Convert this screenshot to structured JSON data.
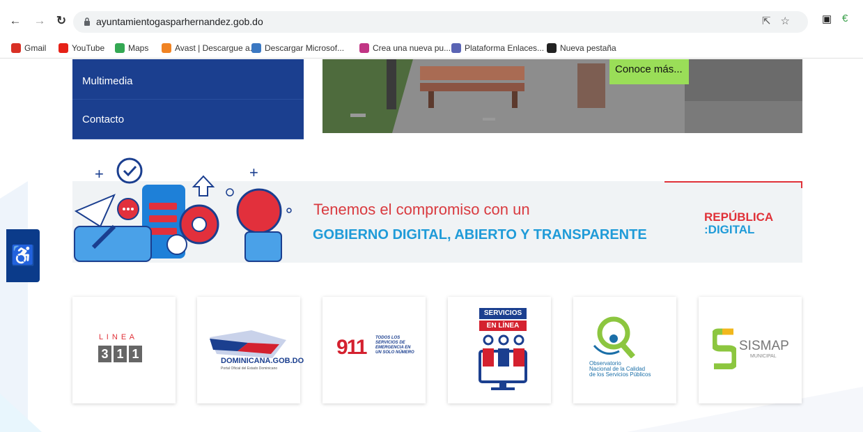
{
  "browser": {
    "url": "ayuntamientogasparhernandez.gob.do",
    "bookmarks": [
      {
        "label": "Gmail",
        "icon": "gmail-icon",
        "color": "#d93025"
      },
      {
        "label": "YouTube",
        "icon": "youtube-icon",
        "color": "#e62117"
      },
      {
        "label": "Maps",
        "icon": "maps-icon",
        "color": "#34a853"
      },
      {
        "label": "Avast | Descargue a...",
        "icon": "avast-icon",
        "color": "#f08323"
      },
      {
        "label": "Descargar Microsof...",
        "icon": "microsoft-icon",
        "color": "#3b78c2"
      },
      {
        "label": "Crea una nueva pu...",
        "icon": "instagram-icon",
        "color": "#c13584"
      },
      {
        "label": "Plataforma Enlaces...",
        "icon": "search-icon",
        "color": "#5a64b4"
      },
      {
        "label": "Nueva pestaña",
        "icon": "globe-icon",
        "color": "#222222"
      }
    ]
  },
  "menu": {
    "items": [
      "Multimedia",
      "Contacto"
    ]
  },
  "hero": {
    "cta": "Conoce más..."
  },
  "banner": {
    "line1": "Tenemos el compromiso con un",
    "line2": "GOBIERNO DIGITAL, ABIERTO Y TRANSPARENTE",
    "brand_top": "REPÚBLICA",
    "brand_bottom": ":DIGITAL"
  },
  "cards": [
    {
      "name": "linea-311-card",
      "top": "L I N E A",
      "digits": [
        "3",
        "1",
        "1"
      ]
    },
    {
      "name": "dominicana-card",
      "label": "DOMINICANA.GOB.DO",
      "sub": "Portal Oficial del Estado Dominicano"
    },
    {
      "name": "911-card",
      "num": "911",
      "lines": [
        "TODOS LOS",
        "SERVICIOS DE",
        "EMERGENCIA EN",
        "UN SOLO NÚMERO"
      ]
    },
    {
      "name": "servicios-card",
      "top": "SERVICIOS",
      "bottom": "EN LÍNEA"
    },
    {
      "name": "observatorio-card",
      "lines": [
        "Observatorio",
        "Nacional de la Calidad",
        "de los Servicios Públicos"
      ]
    },
    {
      "name": "sismap-card",
      "title": "SISMAP",
      "sub": "MUNICIPAL"
    }
  ],
  "colors": {
    "menu_bg": "#1b3f8f",
    "cta_bg": "#9ade58",
    "banner_red": "#d93a3f",
    "banner_blue": "#1f9bd8"
  }
}
